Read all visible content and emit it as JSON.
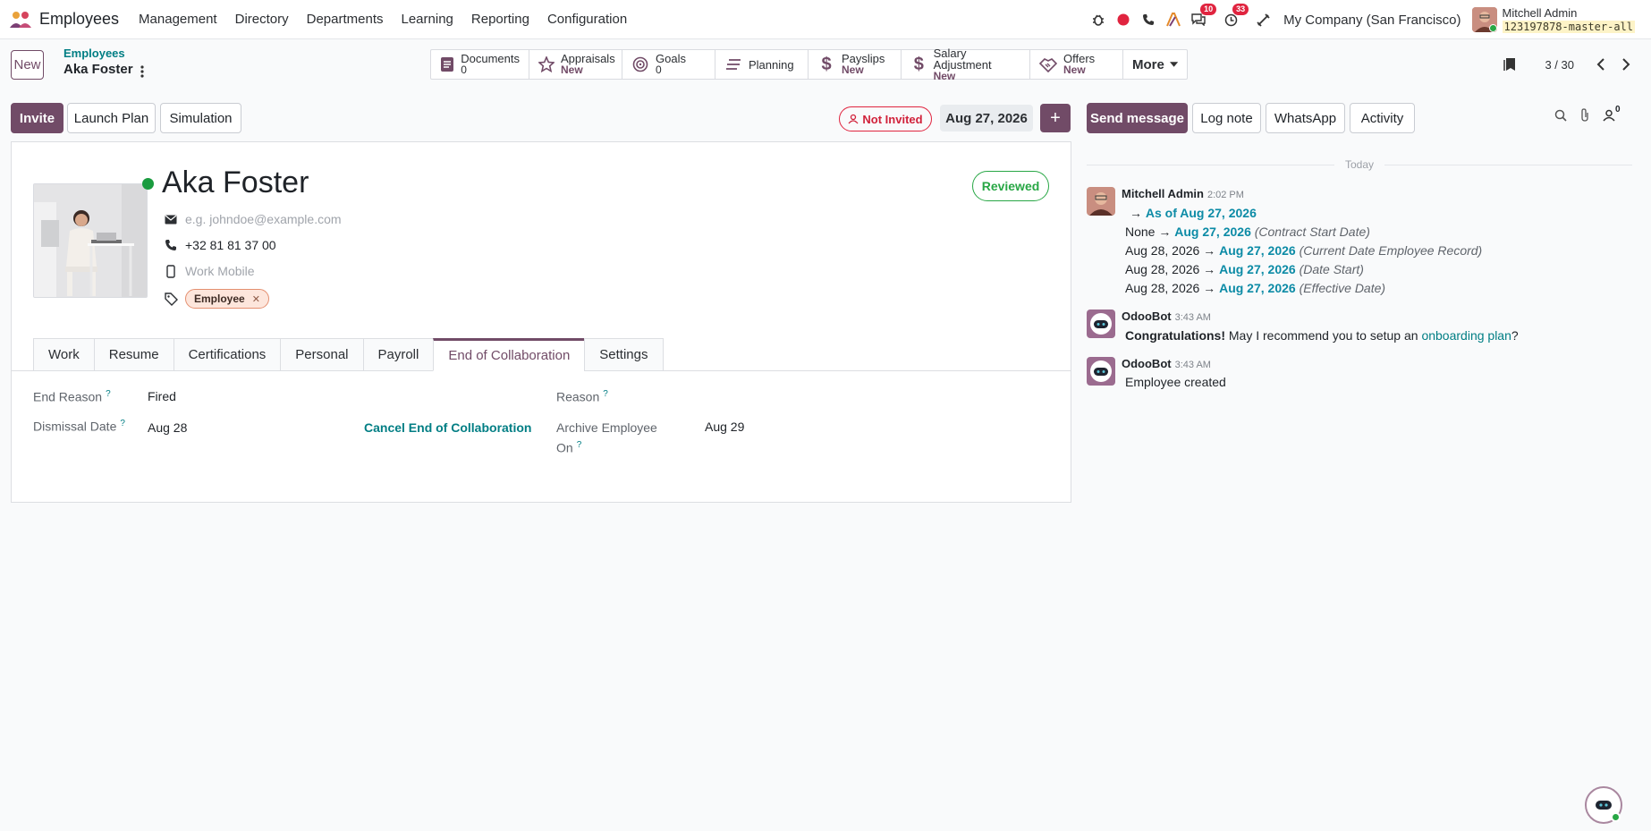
{
  "navbar": {
    "app_name": "Employees",
    "menu": [
      "Management",
      "Directory",
      "Departments",
      "Learning",
      "Reporting",
      "Configuration"
    ],
    "messages_badge": "10",
    "activities_badge": "33",
    "company": "My Company (San Francisco)",
    "user_name": "Mitchell Admin",
    "db_name": "123197878-master-all"
  },
  "control": {
    "new_label": "New",
    "breadcrumb_parent": "Employees",
    "breadcrumb_current": "Aka Foster",
    "pager": "3 / 30"
  },
  "smart_buttons": {
    "documents": {
      "label": "Documents",
      "value": "0"
    },
    "appraisals": {
      "label": "Appraisals",
      "value": "New"
    },
    "goals": {
      "label": "Goals",
      "value": "0"
    },
    "planning": {
      "label": "Planning"
    },
    "payslips": {
      "label": "Payslips",
      "value": "New"
    },
    "salary": {
      "label": "Salary Adjustment",
      "value": "New"
    },
    "offers": {
      "label": "Offers",
      "value": "New"
    },
    "more": "More"
  },
  "statusbar": {
    "invite": "Invite",
    "launch_plan": "Launch Plan",
    "simulation": "Simulation",
    "not_invited": "Not Invited",
    "date": "Aug 27, 2026",
    "plus": "+"
  },
  "employee": {
    "name": "Aka Foster",
    "reviewed": "Reviewed",
    "email_placeholder": "e.g. johndoe@example.com",
    "phone": "+32 81 81 37 00",
    "mobile_placeholder": "Work Mobile",
    "tag": "Employee"
  },
  "tabs": [
    "Work",
    "Resume",
    "Certifications",
    "Personal",
    "Payroll",
    "End of Collaboration",
    "Settings"
  ],
  "end_collab": {
    "end_reason_label": "End Reason",
    "end_reason": "Fired",
    "dismissal_label": "Dismissal Date",
    "dismissal_date": "Aug 28",
    "cancel_link": "Cancel End of Collaboration",
    "reason_label": "Reason",
    "archive_label_1": "Archive Employee",
    "archive_label_2": "On",
    "archive_date": "Aug 29",
    "help": "?"
  },
  "chatter": {
    "send_message": "Send message",
    "log_note": "Log note",
    "whatsapp": "WhatsApp",
    "activity": "Activity",
    "followers": "0",
    "today": "Today",
    "messages": [
      {
        "author": "Mitchell Admin",
        "time": "2:02 PM",
        "lines": [
          {
            "from": "",
            "to": "As of Aug 27, 2026",
            "label": ""
          },
          {
            "from": "None",
            "to": "Aug 27, 2026",
            "label": "(Contract Start Date)"
          },
          {
            "from": "Aug 28, 2026",
            "to": "Aug 27, 2026",
            "label": "(Current Date Employee Record)"
          },
          {
            "from": "Aug 28, 2026",
            "to": "Aug 27, 2026",
            "label": "(Date Start)"
          },
          {
            "from": "Aug 28, 2026",
            "to": "Aug 27, 2026",
            "label": "(Effective Date)"
          }
        ]
      },
      {
        "author": "OdooBot",
        "time": "3:43 AM",
        "bold": "Congratulations!",
        "text": "May I recommend you to setup an",
        "link": "onboarding plan",
        "end": "?"
      },
      {
        "author": "OdooBot",
        "time": "3:43 AM",
        "text": "Employee created"
      }
    ]
  },
  "colors": {
    "brand": "#714b67",
    "link": "#017e84",
    "danger": "#e0243f",
    "success": "#28a745"
  }
}
